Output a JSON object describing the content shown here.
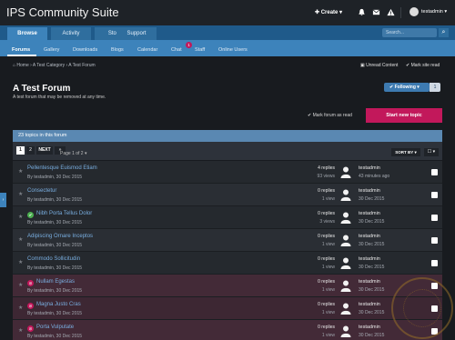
{
  "header": {
    "site_title": "IPS Community Suite",
    "create_label": "✚ Create ▾",
    "username": "testadmin ▾"
  },
  "nav_primary": [
    "Browse",
    "Activity",
    "Store",
    "Support"
  ],
  "search": {
    "placeholder": "Search..."
  },
  "nav_secondary": [
    "Forums",
    "Gallery",
    "Downloads",
    "Blogs",
    "Calendar",
    "Chat",
    "Staff",
    "Online Users"
  ],
  "chat_badge": "1",
  "breadcrumb": "⌂ Home  ›  A Test Category  ›  A Test Forum",
  "unread_content": "Unread Content",
  "mark_site_read": "Mark site read",
  "forum": {
    "title": "A Test Forum",
    "description": "A test forum that may be removed at any time.",
    "following_label": "✔ Following ▾",
    "following_count": "1",
    "mark_read_label": "✔ Mark forum as read",
    "new_topic_label": "Start new topic"
  },
  "topics_count": "23 topics in this forum",
  "pagination": {
    "p1": "1",
    "p2": "2",
    "next": "NEXT",
    "last": "»",
    "page_of": "Page 1 of 2 ▾"
  },
  "sort_label": "SORT BY ▾",
  "select_label": "☐ ▾",
  "topics": [
    {
      "title": "Pellentesque Euismod Etiam",
      "meta": "By testadmin, 30 Dec 2015",
      "replies": "4 replies",
      "views": "93 views",
      "last_user": "testadmin",
      "last_date": "43 minutes ago",
      "status": ""
    },
    {
      "title": "Consectetur",
      "meta": "By testadmin, 30 Dec 2015",
      "replies": "0 replies",
      "views": "1 view",
      "last_user": "testadmin",
      "last_date": "30 Dec 2015",
      "status": ""
    },
    {
      "title": "Nibh Porta Tellus Dolor",
      "meta": "By testadmin, 30 Dec 2015",
      "replies": "0 replies",
      "views": "3 views",
      "last_user": "testadmin",
      "last_date": "30 Dec 2015",
      "status": "✔"
    },
    {
      "title": "Adipiscing Ornare Inceptos",
      "meta": "By testadmin, 30 Dec 2015",
      "replies": "0 replies",
      "views": "1 view",
      "last_user": "testadmin",
      "last_date": "30 Dec 2015",
      "status": ""
    },
    {
      "title": "Commodo Sollicitudin",
      "meta": "By testadmin, 30 Dec 2015",
      "replies": "0 replies",
      "views": "1 view",
      "last_user": "testadmin",
      "last_date": "30 Dec 2015",
      "status": ""
    },
    {
      "title": "Nullam Egestas",
      "meta": "By testadmin, 30 Dec 2015",
      "replies": "0 replies",
      "views": "1 view",
      "last_user": "testadmin",
      "last_date": "30 Dec 2015",
      "status": "⊘"
    },
    {
      "title": "Magna Justo Cras",
      "meta": "By testadmin, 30 Dec 2015",
      "replies": "0 replies",
      "views": "1 view",
      "last_user": "testadmin",
      "last_date": "30 Dec 2015",
      "status": "⊘"
    },
    {
      "title": "Porta Vulputate",
      "meta": "By testadmin, 30 Dec 2015",
      "replies": "0 replies",
      "views": "1 view",
      "last_user": "testadmin",
      "last_date": "30 Dec 2015",
      "status": "⊘"
    }
  ],
  "colors": {
    "accent": "#3d83bb",
    "primary_action": "#c2185b",
    "approved": "#4caf50",
    "hidden": "#c2185b"
  }
}
